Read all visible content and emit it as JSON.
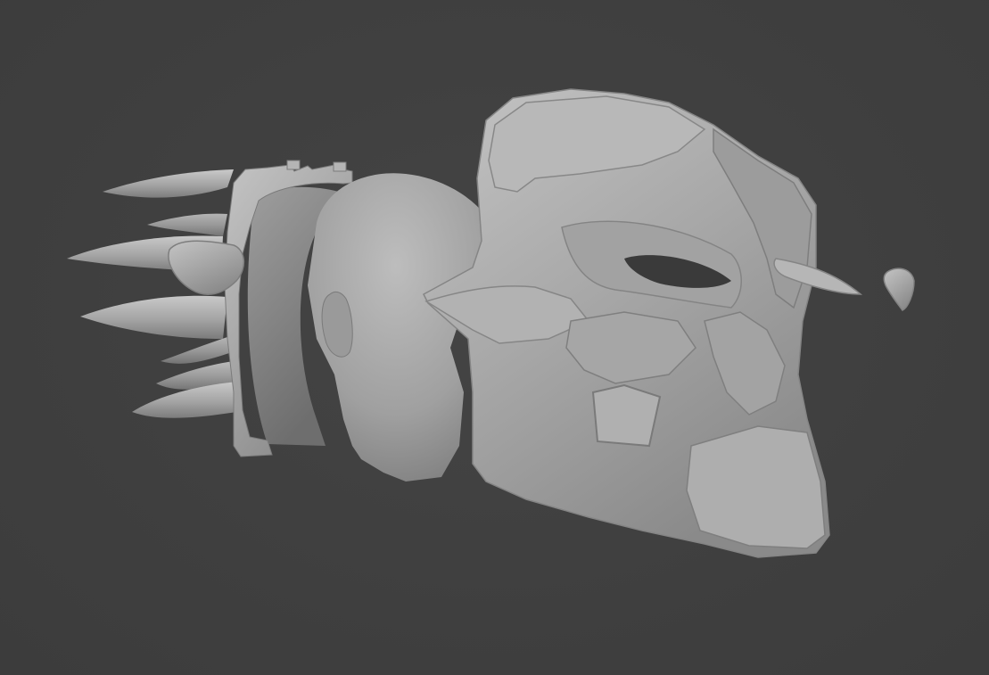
{
  "scene": {
    "background_color": "#404040",
    "clay_color": "#a9a9a9",
    "objects": [
      "spiked-back-armor",
      "head-bust",
      "helmet-mask",
      "detached-horn-piece"
    ]
  }
}
